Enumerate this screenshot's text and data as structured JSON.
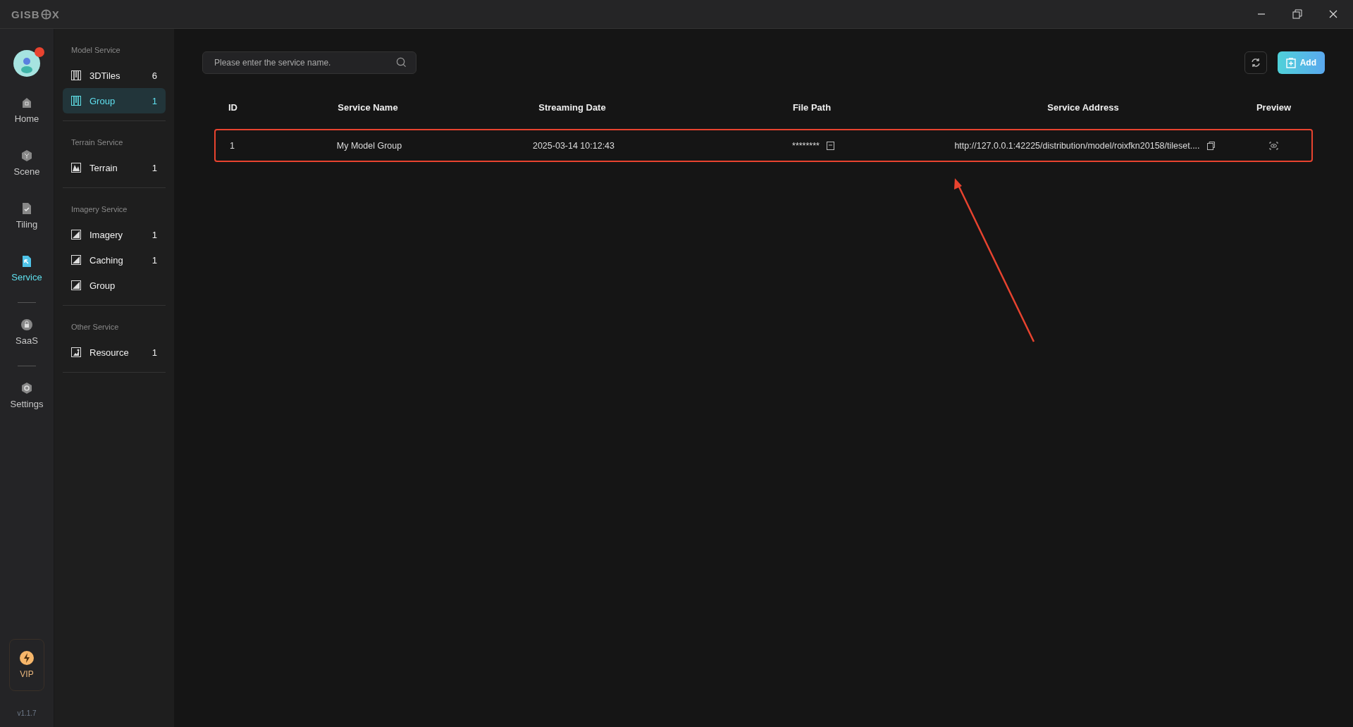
{
  "app": {
    "logo_left": "GISB",
    "logo_right": "X"
  },
  "nav": {
    "items": [
      {
        "label": "Home",
        "selected": false
      },
      {
        "label": "Scene",
        "selected": false
      },
      {
        "label": "Tiling",
        "selected": false
      },
      {
        "label": "Service",
        "selected": true
      },
      {
        "label": "SaaS",
        "selected": false
      },
      {
        "label": "Settings",
        "selected": false
      }
    ],
    "vip": "VIP",
    "version": "v1.1.7"
  },
  "sidebar": {
    "sections": [
      {
        "title": "Model Service",
        "items": [
          {
            "label": "3DTiles",
            "count": "6",
            "selected": false
          },
          {
            "label": "Group",
            "count": "1",
            "selected": true
          }
        ]
      },
      {
        "title": "Terrain Service",
        "items": [
          {
            "label": "Terrain",
            "count": "1",
            "selected": false
          }
        ]
      },
      {
        "title": "Imagery Service",
        "items": [
          {
            "label": "Imagery",
            "count": "1",
            "selected": false
          },
          {
            "label": "Caching",
            "count": "1",
            "selected": false
          },
          {
            "label": "Group",
            "selected": false
          }
        ]
      },
      {
        "title": "Other Service",
        "items": [
          {
            "label": "Resource",
            "count": "1",
            "selected": false
          }
        ]
      }
    ]
  },
  "search": {
    "placeholder": "Please enter the service name."
  },
  "toolbar": {
    "add_label": "Add"
  },
  "table": {
    "columns": [
      "ID",
      "Service Name",
      "Streaming Date",
      "File Path",
      "Service Address",
      "Preview"
    ],
    "rows": [
      {
        "id": "1",
        "name": "My Model Group",
        "date": "2025-03-14 10:12:43",
        "file_path": "********",
        "address": "http://127.0.0.1:42225/distribution/model/roixfkn20158/tileset....",
        "highlighted": true
      }
    ]
  },
  "annotation_arrow": true
}
